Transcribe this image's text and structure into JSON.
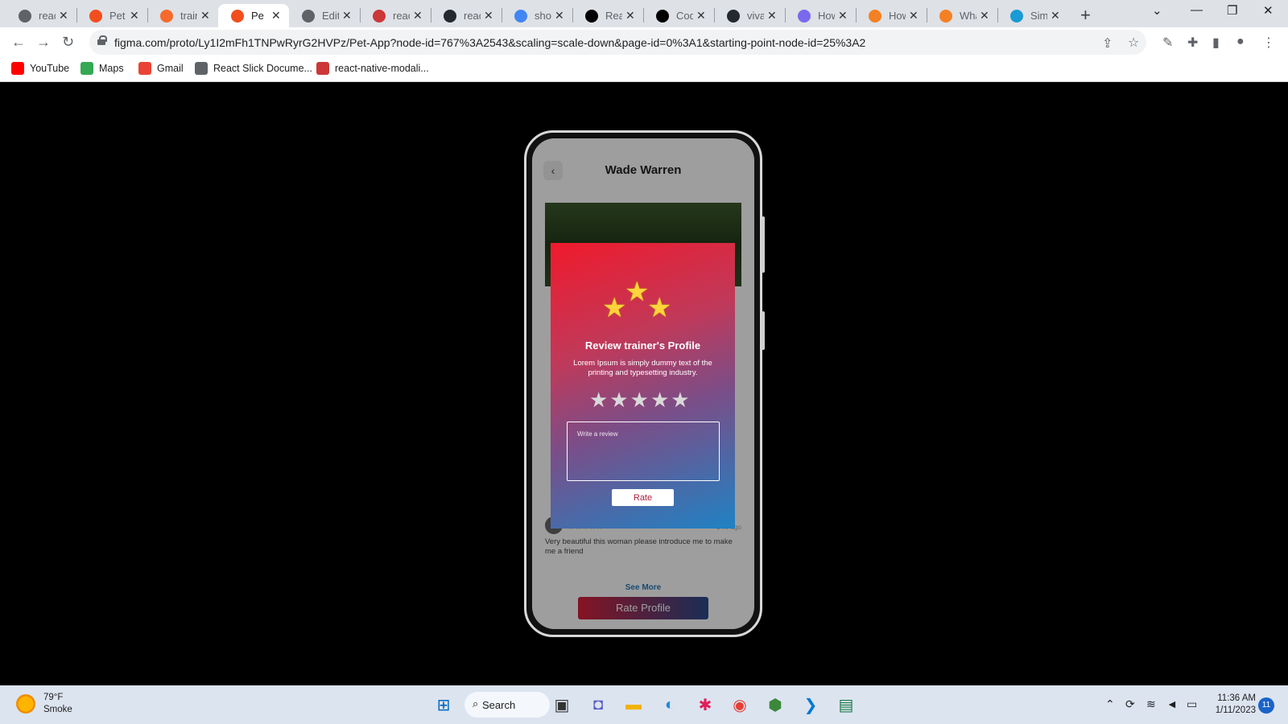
{
  "browser": {
    "tabs": [
      {
        "label": "react",
        "icon": "globe-icon",
        "color": "#5f6368"
      },
      {
        "label": "Pet A",
        "icon": "figma-icon",
        "color": "#f24e1e"
      },
      {
        "label": "train",
        "icon": "brand-icon",
        "color": "#f86a2b"
      },
      {
        "label": "Pe",
        "icon": "figma-icon",
        "color": "#f24e1e",
        "active": true
      },
      {
        "label": "Edit",
        "icon": "globe-icon",
        "color": "#5f6368"
      },
      {
        "label": "reac",
        "icon": "npm-icon",
        "color": "#cb3837"
      },
      {
        "label": "reac",
        "icon": "github-icon",
        "color": "#24292f"
      },
      {
        "label": "sho",
        "icon": "google-icon",
        "color": "#4285f4"
      },
      {
        "label": "Reac",
        "icon": "medium-icon",
        "color": "#000000"
      },
      {
        "label": "Code",
        "icon": "dev-icon",
        "color": "#000000"
      },
      {
        "label": "viva",
        "icon": "github-icon",
        "color": "#24292f"
      },
      {
        "label": "How",
        "icon": "link-icon",
        "color": "#7b68ee"
      },
      {
        "label": "How",
        "icon": "stackoverflow-icon",
        "color": "#f48024"
      },
      {
        "label": "Wha",
        "icon": "stackoverflow-icon",
        "color": "#f48024"
      },
      {
        "label": "Simp",
        "icon": "globe-icon",
        "color": "#1a9ad6"
      }
    ],
    "url": "figma.com/proto/Ly1I2mFh1TNPwRyrG2HVPz/Pet-App?node-id=767%3A2543&scaling=scale-down&page-id=0%3A1&starting-point-node-id=25%3A2",
    "bookmarks": [
      {
        "label": "YouTube",
        "icon": "youtube-icon",
        "color": "#ff0000"
      },
      {
        "label": "Maps",
        "icon": "maps-icon",
        "color": "#34a853"
      },
      {
        "label": "Gmail",
        "icon": "gmail-icon",
        "color": "#ea4335"
      },
      {
        "label": "React Slick Docume...",
        "icon": "globe-icon",
        "color": "#5f6368"
      },
      {
        "label": "react-native-modali...",
        "icon": "npm-icon",
        "color": "#cb3837"
      }
    ]
  },
  "app": {
    "title": "Wade Warren",
    "reviews": [
      {
        "text": "Very beautiful this woman please introduce me to make me a friend",
        "stars": "★★★★★",
        "time": "2 Hr ago"
      }
    ],
    "see_more": "See More",
    "rate_profile": "Rate Profile"
  },
  "modal": {
    "title": "Review trainer's Profile",
    "description": "Lorem Ipsum is simply dummy text of the printing and typesetting industry.",
    "rating_stars": 5,
    "selected_rating": 0,
    "review_placeholder": "Write a review",
    "rate_button": "Rate"
  },
  "taskbar": {
    "weather_temp": "79°F",
    "weather_desc": "Smoke",
    "search_label": "Search",
    "time": "11:36 AM",
    "date": "1/11/2023",
    "notifications": "11"
  }
}
